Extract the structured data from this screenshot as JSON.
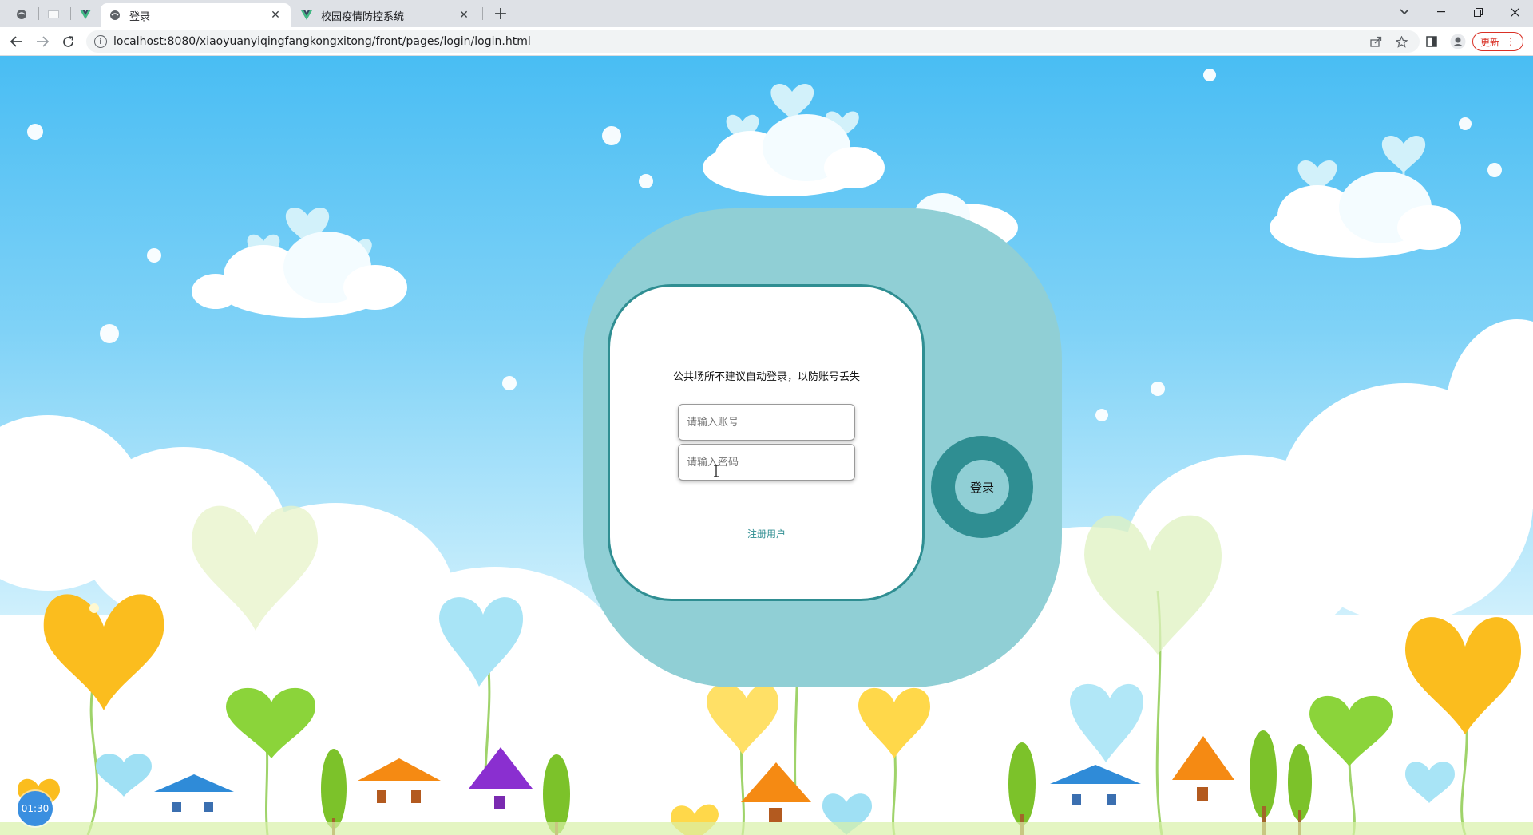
{
  "browser": {
    "tabs": [
      {
        "title": "登录",
        "active": true
      },
      {
        "title": "校园疫情防控系统",
        "active": false
      }
    ],
    "url": "localhost:8080/xiaoyuanyiqingfangkongxitong/front/pages/login/login.html",
    "update_label": "更新"
  },
  "login": {
    "notice": "公共场所不建议自动登录，以防账号丢失",
    "account_placeholder": "请输入账号",
    "password_placeholder": "请输入密码",
    "register_label": "注册用户",
    "login_label": "登录"
  },
  "timer": {
    "value": "01:30"
  },
  "colors": {
    "teal_dark": "#2f8e92",
    "teal_light": "#90cfd5",
    "sky": "#49bdf3"
  }
}
